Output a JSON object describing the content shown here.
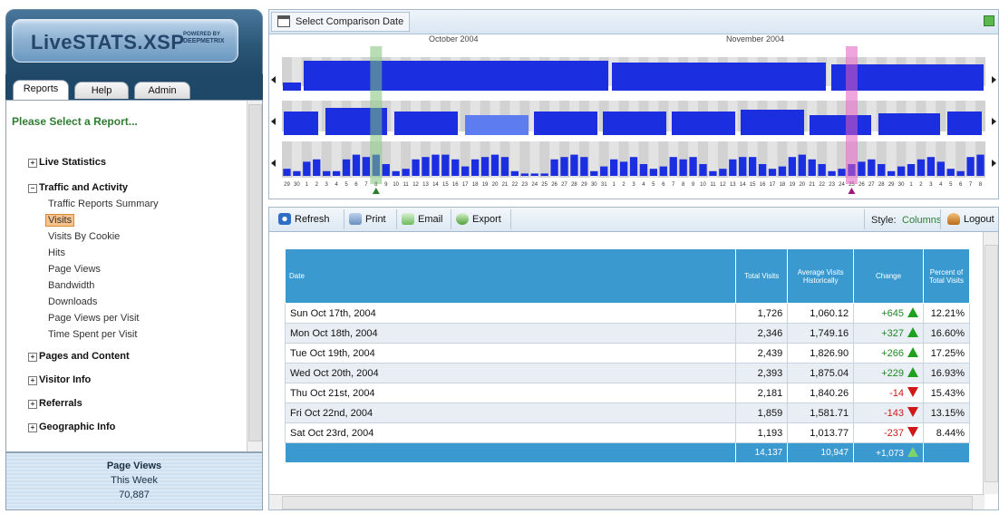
{
  "logo": {
    "title": "LiveSTATS.XSP",
    "powered": "POWERED BY",
    "brand": "DEEPMETRIX"
  },
  "tabs": [
    {
      "label": "Reports",
      "active": true
    },
    {
      "label": "Help"
    },
    {
      "label": "Admin"
    }
  ],
  "reports": {
    "heading": "Please Select a Report...",
    "groups": [
      {
        "label": "Live Statistics",
        "expander": "+"
      },
      {
        "label": "Traffic and Activity",
        "expander": "−"
      },
      {
        "label": "Pages and Content",
        "expander": "+"
      },
      {
        "label": "Visitor Info",
        "expander": "+"
      },
      {
        "label": "Referrals",
        "expander": "+"
      },
      {
        "label": "Geographic Info",
        "expander": "+"
      }
    ],
    "traffic_items": [
      "Traffic Reports Summary",
      "Visits",
      "Visits By Cookie",
      "Hits",
      "Page Views",
      "Bandwidth",
      "Downloads",
      "Page Views per Visit",
      "Time Spent per Visit"
    ],
    "selected_item": "Visits"
  },
  "page_views_box": {
    "title": "Page Views",
    "period": "This Week",
    "value": "70,887"
  },
  "comparison": {
    "button_label": "Select Comparison Date",
    "months": [
      "October 2004",
      "November 2004"
    ],
    "day_labels": [
      "29",
      "30",
      "1",
      "2",
      "3",
      "4",
      "5",
      "6",
      "7",
      "8",
      "9",
      "10",
      "11",
      "12",
      "13",
      "14",
      "15",
      "16",
      "17",
      "18",
      "19",
      "20",
      "21",
      "22",
      "23",
      "24",
      "25",
      "26",
      "27",
      "28",
      "29",
      "30",
      "31",
      "1",
      "2",
      "3",
      "4",
      "5",
      "6",
      "7",
      "8",
      "9",
      "10",
      "11",
      "12",
      "13",
      "14",
      "15",
      "16",
      "17",
      "18",
      "19",
      "20",
      "21",
      "22",
      "23",
      "24",
      "25",
      "26",
      "27",
      "28",
      "29",
      "30",
      "1",
      "2",
      "3",
      "4",
      "5",
      "6",
      "7",
      "8"
    ],
    "colors": {
      "bar": "#1c2fe0",
      "bar_light": "#5c7cf0",
      "marker_green": "#7fc27a",
      "marker_pink": "#e05ac0"
    }
  },
  "toolbar": {
    "refresh": "Refresh",
    "print": "Print",
    "email": "Email",
    "export": "Export",
    "style_label": "Style:",
    "style_value": "Columns",
    "logout": "Logout"
  },
  "table": {
    "headers": [
      "Date",
      "Total Visits",
      "Average Visits Historically",
      "Change",
      "Percent of Total Visits"
    ],
    "rows": [
      {
        "date": "Sun Oct 17th, 2004",
        "total": "1,726",
        "avg": "1,060.12",
        "change": "+645",
        "dir": "up",
        "pct": "12.21%"
      },
      {
        "date": "Mon Oct 18th, 2004",
        "total": "2,346",
        "avg": "1,749.16",
        "change": "+327",
        "dir": "up",
        "pct": "16.60%"
      },
      {
        "date": "Tue Oct 19th, 2004",
        "total": "2,439",
        "avg": "1,826.90",
        "change": "+266",
        "dir": "up",
        "pct": "17.25%"
      },
      {
        "date": "Wed Oct 20th, 2004",
        "total": "2,393",
        "avg": "1,875.04",
        "change": "+229",
        "dir": "up",
        "pct": "16.93%"
      },
      {
        "date": "Thu Oct 21st, 2004",
        "total": "2,181",
        "avg": "1,840.26",
        "change": "-14",
        "dir": "down",
        "pct": "15.43%"
      },
      {
        "date": "Fri Oct 22nd, 2004",
        "total": "1,859",
        "avg": "1,581.71",
        "change": "-143",
        "dir": "down",
        "pct": "13.15%"
      },
      {
        "date": "Sat Oct 23rd, 2004",
        "total": "1,193",
        "avg": "1,013.77",
        "change": "-237",
        "dir": "down",
        "pct": "8.44%"
      }
    ],
    "totals": {
      "total": "14,137",
      "avg": "10,947",
      "change": "+1,073",
      "dir": "up"
    }
  }
}
